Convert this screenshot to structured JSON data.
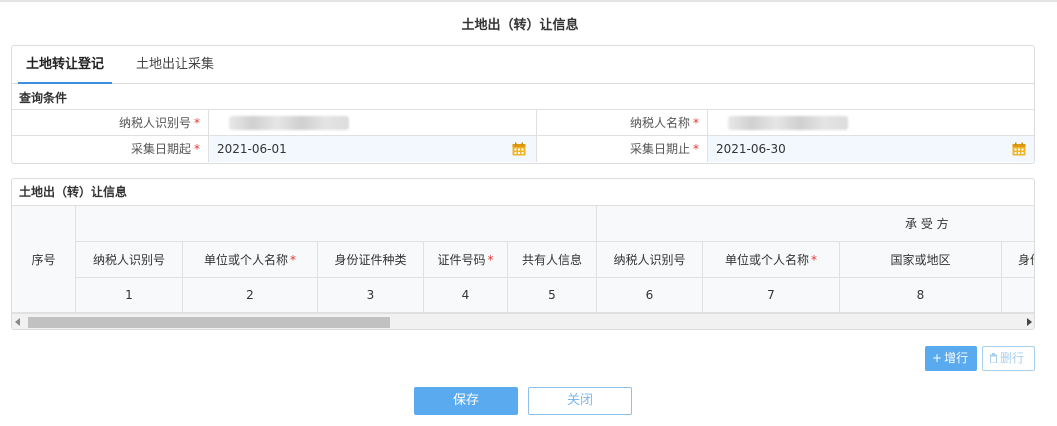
{
  "page_title": "土地出（转）让信息",
  "tabs": [
    {
      "label": "土地转让登记",
      "active": true
    },
    {
      "label": "土地出让采集",
      "active": false
    }
  ],
  "query": {
    "section_title": "查询条件",
    "taxpayer_id_label": "纳税人识别号",
    "taxpayer_name_label": "纳税人名称",
    "date_from_label": "采集日期起",
    "date_from_value": "2021-06-01",
    "date_to_label": "采集日期止",
    "date_to_value": "2021-06-30",
    "required_mark": "*"
  },
  "grid": {
    "section_title": "土地出（转）让信息",
    "seq_header": "序号",
    "group_header": "承 受 方",
    "columns": [
      {
        "label": "纳税人识别号",
        "required": false,
        "num": "1"
      },
      {
        "label": "单位或个人名称",
        "required": true,
        "num": "2"
      },
      {
        "label": "身份证件种类",
        "required": false,
        "num": "3"
      },
      {
        "label": "证件号码",
        "required": true,
        "num": "4"
      },
      {
        "label": "共有人信息",
        "required": false,
        "num": "5"
      },
      {
        "label": "纳税人识别号",
        "required": false,
        "num": "6"
      },
      {
        "label": "单位或个人名称",
        "required": true,
        "num": "7"
      },
      {
        "label": "国家或地区",
        "required": false,
        "num": "8"
      },
      {
        "label": "身份",
        "required": false,
        "num": ""
      }
    ],
    "required_mark": "*"
  },
  "row_buttons": {
    "add_label": "增行",
    "delete_label": "删行"
  },
  "footer_buttons": {
    "save_label": "保存",
    "close_label": "关闭"
  },
  "colors": {
    "primary": "#5aaaf0",
    "required": "#e53935",
    "tab_underline": "#3d8fdc",
    "calendar": "#f0b429"
  }
}
